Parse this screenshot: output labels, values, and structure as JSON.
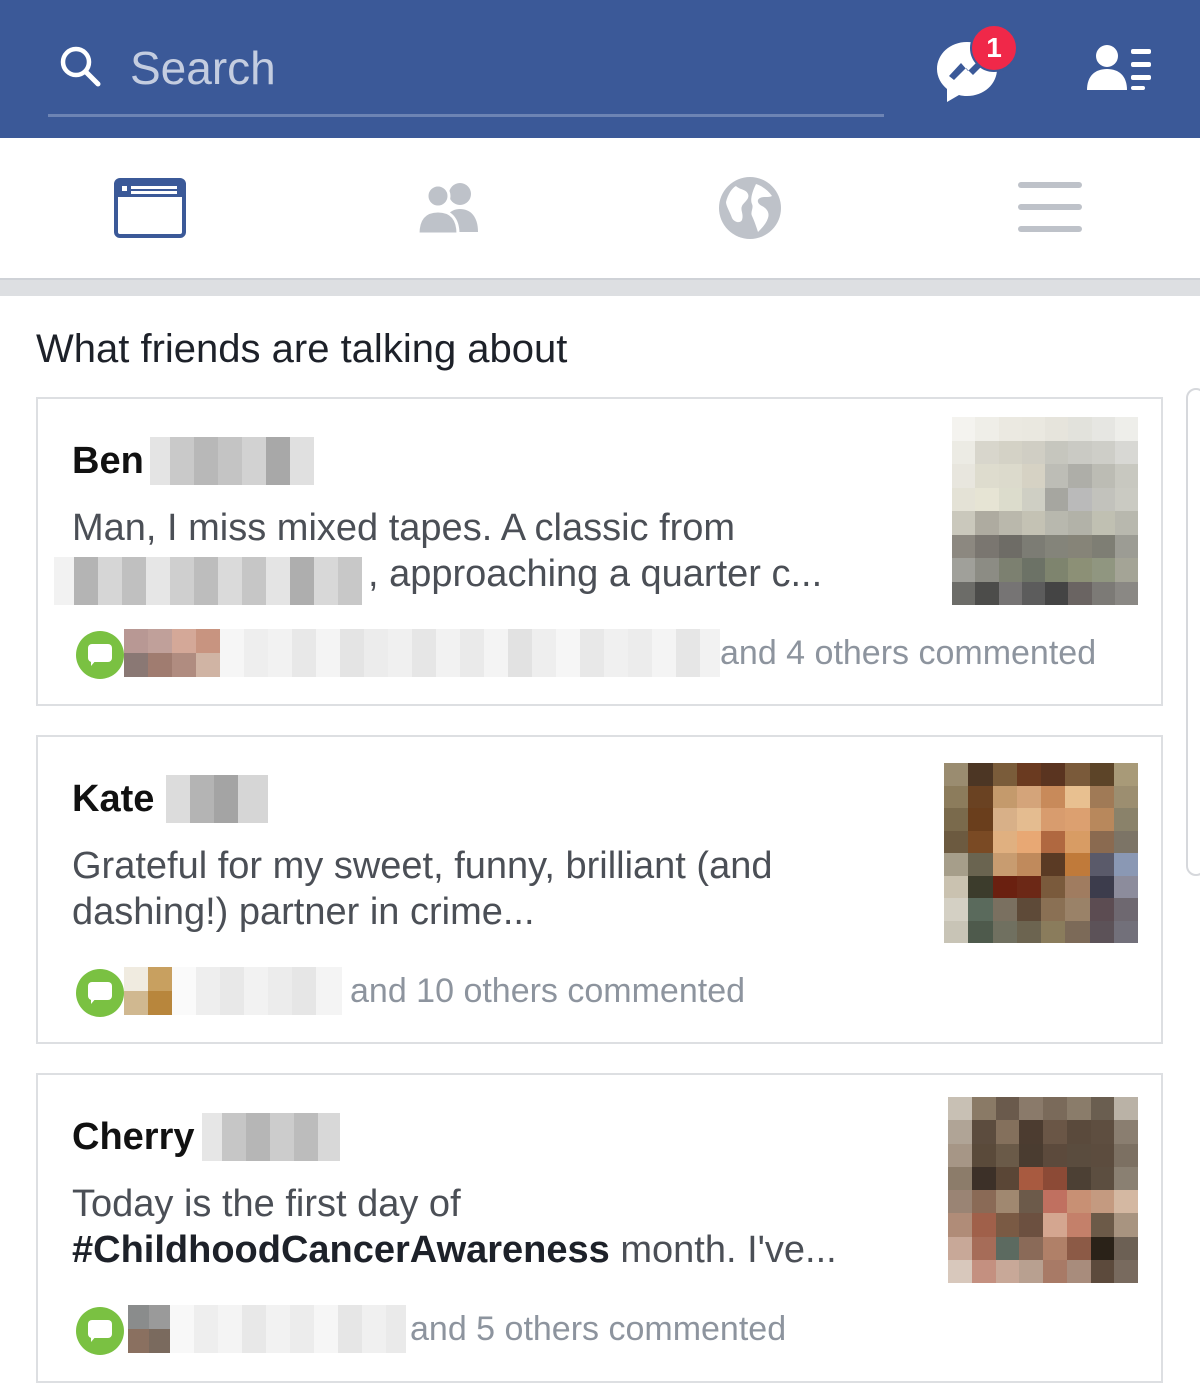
{
  "header": {
    "search_placeholder": "Search",
    "messenger_badge": "1"
  },
  "tabs": [
    {
      "name": "News Feed",
      "icon": "news-feed-icon",
      "active": true
    },
    {
      "name": "Friends",
      "icon": "friends-icon",
      "active": false
    },
    {
      "name": "Notifications",
      "icon": "globe-icon",
      "active": false
    },
    {
      "name": "Menu",
      "icon": "menu-icon",
      "active": false
    }
  ],
  "section": {
    "title": "What friends are talking about"
  },
  "posts": [
    {
      "author": "Ben",
      "text_line1": "Man, I miss mixed tapes. A classic from",
      "text_line2": ", approaching a quarter c...",
      "commented": "and 4 others commented"
    },
    {
      "author": "Kate",
      "text_line1": "Grateful for my sweet, funny, brilliant (and",
      "text_line2": "dashing!) partner in crime...",
      "commented": "and 10 others commented"
    },
    {
      "author": "Cherry",
      "text_line1": "Today is the first day of",
      "hashtag": "#ChildhoodCancerAwareness",
      "text_line2_rest": " month. I've...",
      "commented": "and 5 others commented"
    }
  ],
  "colors": {
    "brand": "#3b5998",
    "badge": "#f02849",
    "comment_green": "#7ac142",
    "muted_text": "#8d949e"
  }
}
